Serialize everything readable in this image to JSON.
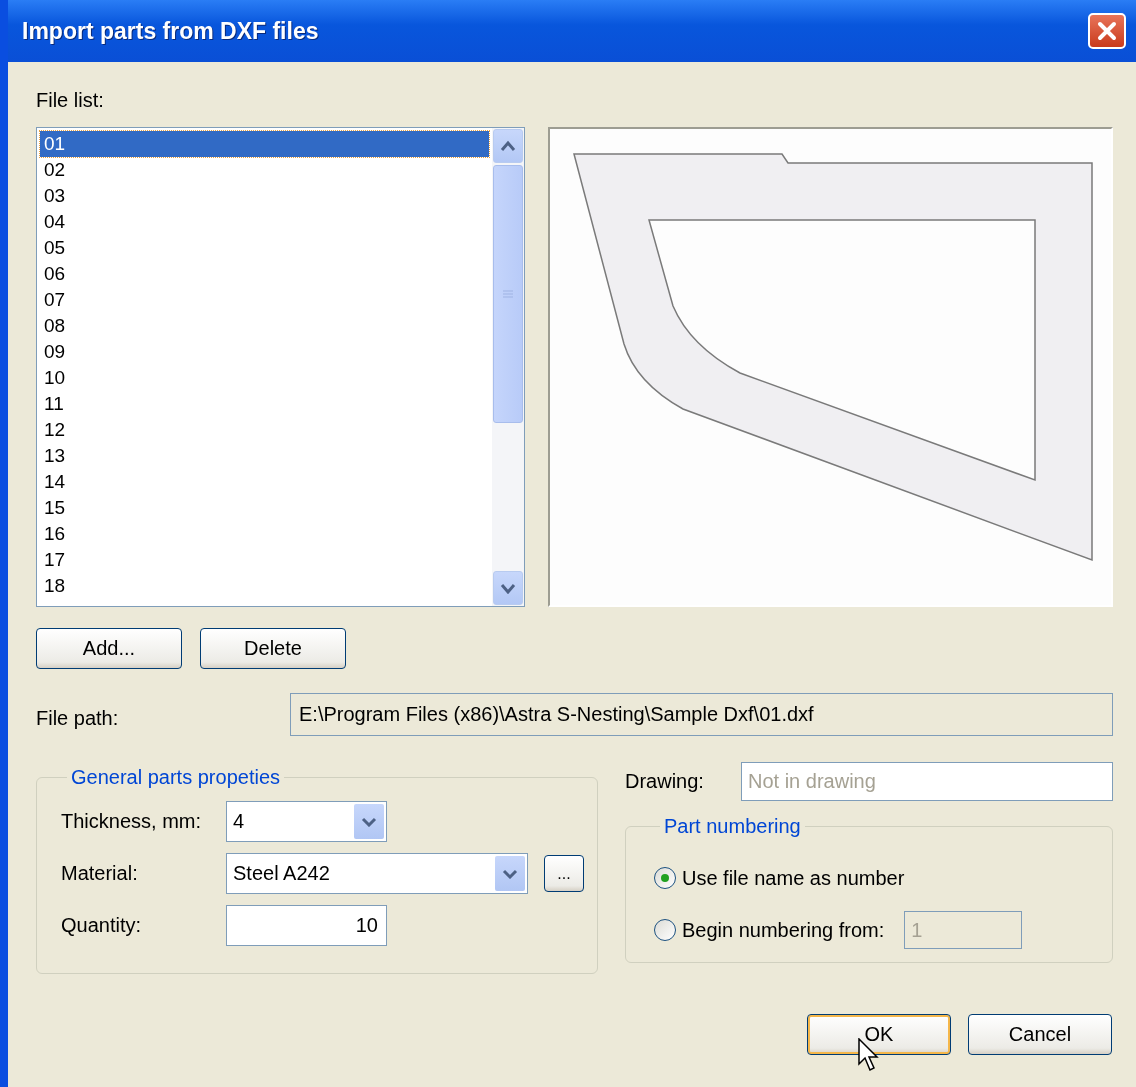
{
  "window": {
    "title": "Import parts from DXF files"
  },
  "file_list": {
    "label": "File list:",
    "items": [
      {
        "name": "01",
        "selected": true
      },
      {
        "name": "02",
        "selected": false
      },
      {
        "name": "03",
        "selected": false
      },
      {
        "name": "04",
        "selected": false
      },
      {
        "name": "05",
        "selected": false
      },
      {
        "name": "06",
        "selected": false
      },
      {
        "name": "07",
        "selected": false
      },
      {
        "name": "08",
        "selected": false
      },
      {
        "name": "09",
        "selected": false
      },
      {
        "name": "10",
        "selected": false
      },
      {
        "name": "11",
        "selected": false
      },
      {
        "name": "12",
        "selected": false
      },
      {
        "name": "13",
        "selected": false
      },
      {
        "name": "14",
        "selected": false
      },
      {
        "name": "15",
        "selected": false
      },
      {
        "name": "16",
        "selected": false
      },
      {
        "name": "17",
        "selected": false
      },
      {
        "name": "18",
        "selected": false
      }
    ]
  },
  "list_buttons": [
    "Add...",
    "Delete"
  ],
  "file_path": {
    "label": "File path:",
    "value": "E:\\Program Files (x86)\\Astra S-Nesting\\Sample Dxf\\01.dxf"
  },
  "general": {
    "title": "General parts propeties",
    "thickness": {
      "label": "Thickness, mm:",
      "value": "4"
    },
    "material": {
      "label": "Material:",
      "value": "Steel A242",
      "browse": "..."
    },
    "quantity": {
      "label": "Quantity:",
      "value": "10"
    }
  },
  "drawing": {
    "label": "Drawing:",
    "value": "Not in drawing",
    "disabled": true
  },
  "part_numbering": {
    "title": "Part numbering",
    "options": [
      {
        "label": "Use file name as number",
        "selected": true
      },
      {
        "label": "Begin numbering from:",
        "selected": false,
        "field": {
          "value": "1",
          "disabled": true
        }
      }
    ]
  },
  "dialog_buttons": [
    {
      "label": "OK",
      "default": true
    },
    {
      "label": "Cancel",
      "default": false
    }
  ]
}
